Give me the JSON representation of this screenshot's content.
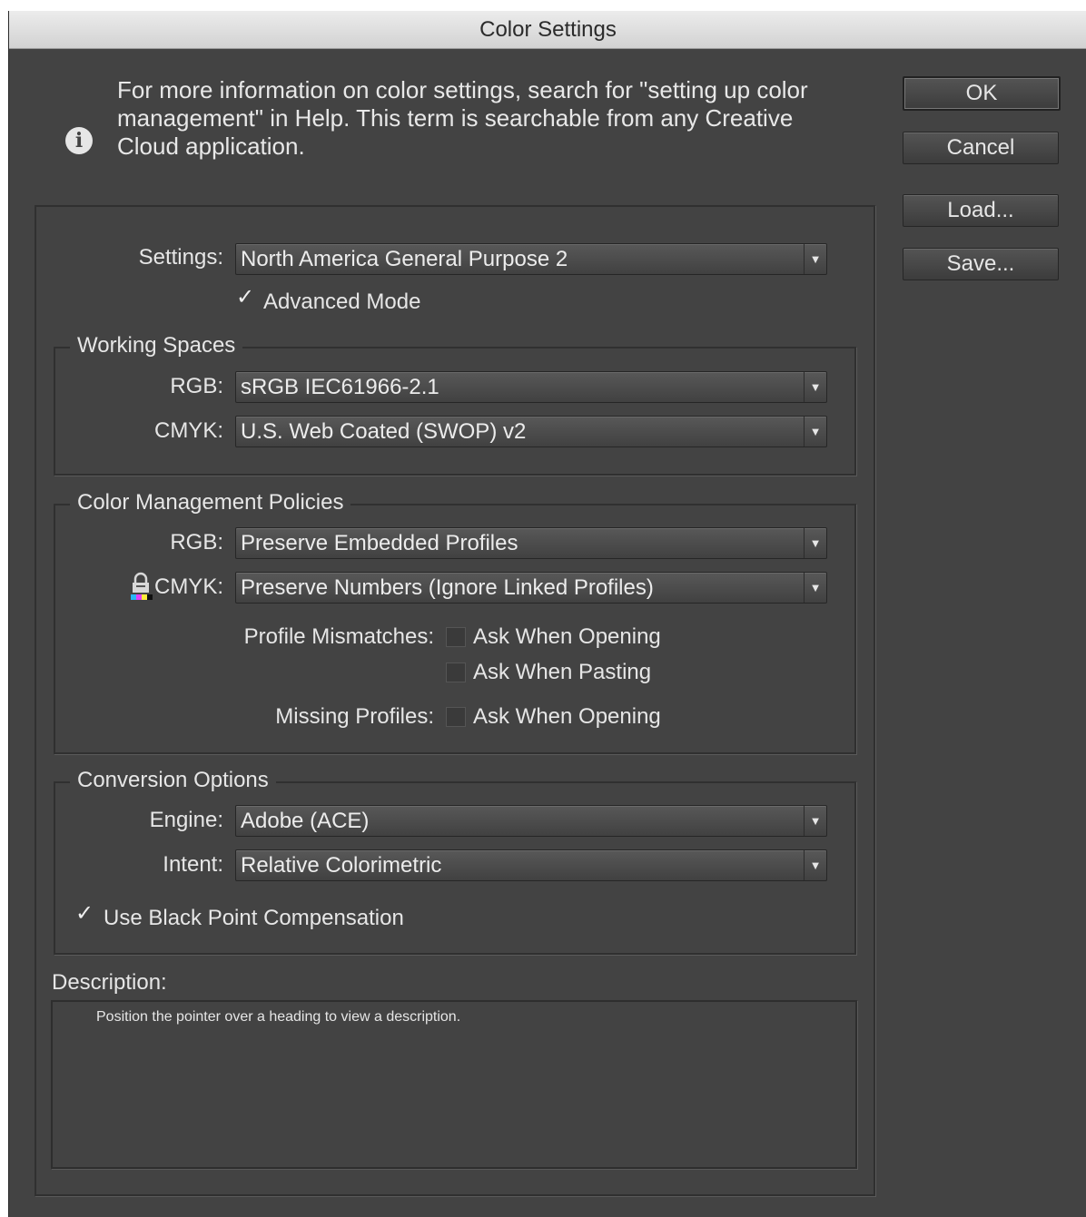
{
  "window": {
    "title": "Color Settings"
  },
  "info": {
    "line1": "For more information on color settings, search for \"setting up color",
    "line2": "management\" in Help. This term is searchable from any Creative",
    "line3": "Cloud application."
  },
  "buttons": {
    "ok": "OK",
    "cancel": "Cancel",
    "load": "Load...",
    "save": "Save..."
  },
  "settings": {
    "label": "Settings:",
    "value": "North America General Purpose 2",
    "advanced_mode_label": "Advanced Mode",
    "advanced_mode_checked": true
  },
  "working_spaces": {
    "title": "Working Spaces",
    "rgb_label": "RGB:",
    "rgb_value": "sRGB IEC61966-2.1",
    "cmyk_label": "CMYK:",
    "cmyk_value": "U.S. Web Coated (SWOP) v2"
  },
  "policies": {
    "title": "Color Management Policies",
    "rgb_label": "RGB:",
    "rgb_value": "Preserve Embedded Profiles",
    "cmyk_label": "CMYK:",
    "cmyk_value": "Preserve Numbers (Ignore Linked Profiles)",
    "profile_mismatches_label": "Profile Mismatches:",
    "ask_when_opening": "Ask When Opening",
    "ask_when_pasting": "Ask When Pasting",
    "missing_profiles_label": "Missing Profiles:",
    "missing_ask_when_opening": "Ask When Opening",
    "mismatch_open_checked": false,
    "mismatch_paste_checked": false,
    "missing_open_checked": false
  },
  "conversion": {
    "title": "Conversion Options",
    "engine_label": "Engine:",
    "engine_value": "Adobe (ACE)",
    "intent_label": "Intent:",
    "intent_value": "Relative Colorimetric",
    "black_point_label": "Use Black Point Compensation",
    "black_point_checked": true
  },
  "description": {
    "label": "Description:",
    "text": "Position the pointer over a heading to view a description."
  },
  "colors": {
    "dialog_bg": "#434343",
    "titlebar_bg": "#d8d8d8",
    "text": "#e6e6e6"
  },
  "icons": {
    "info": "info-icon",
    "lock": "lock-icon",
    "dropdown": "dropdown-arrow-icon",
    "check": "checkmark-icon"
  }
}
